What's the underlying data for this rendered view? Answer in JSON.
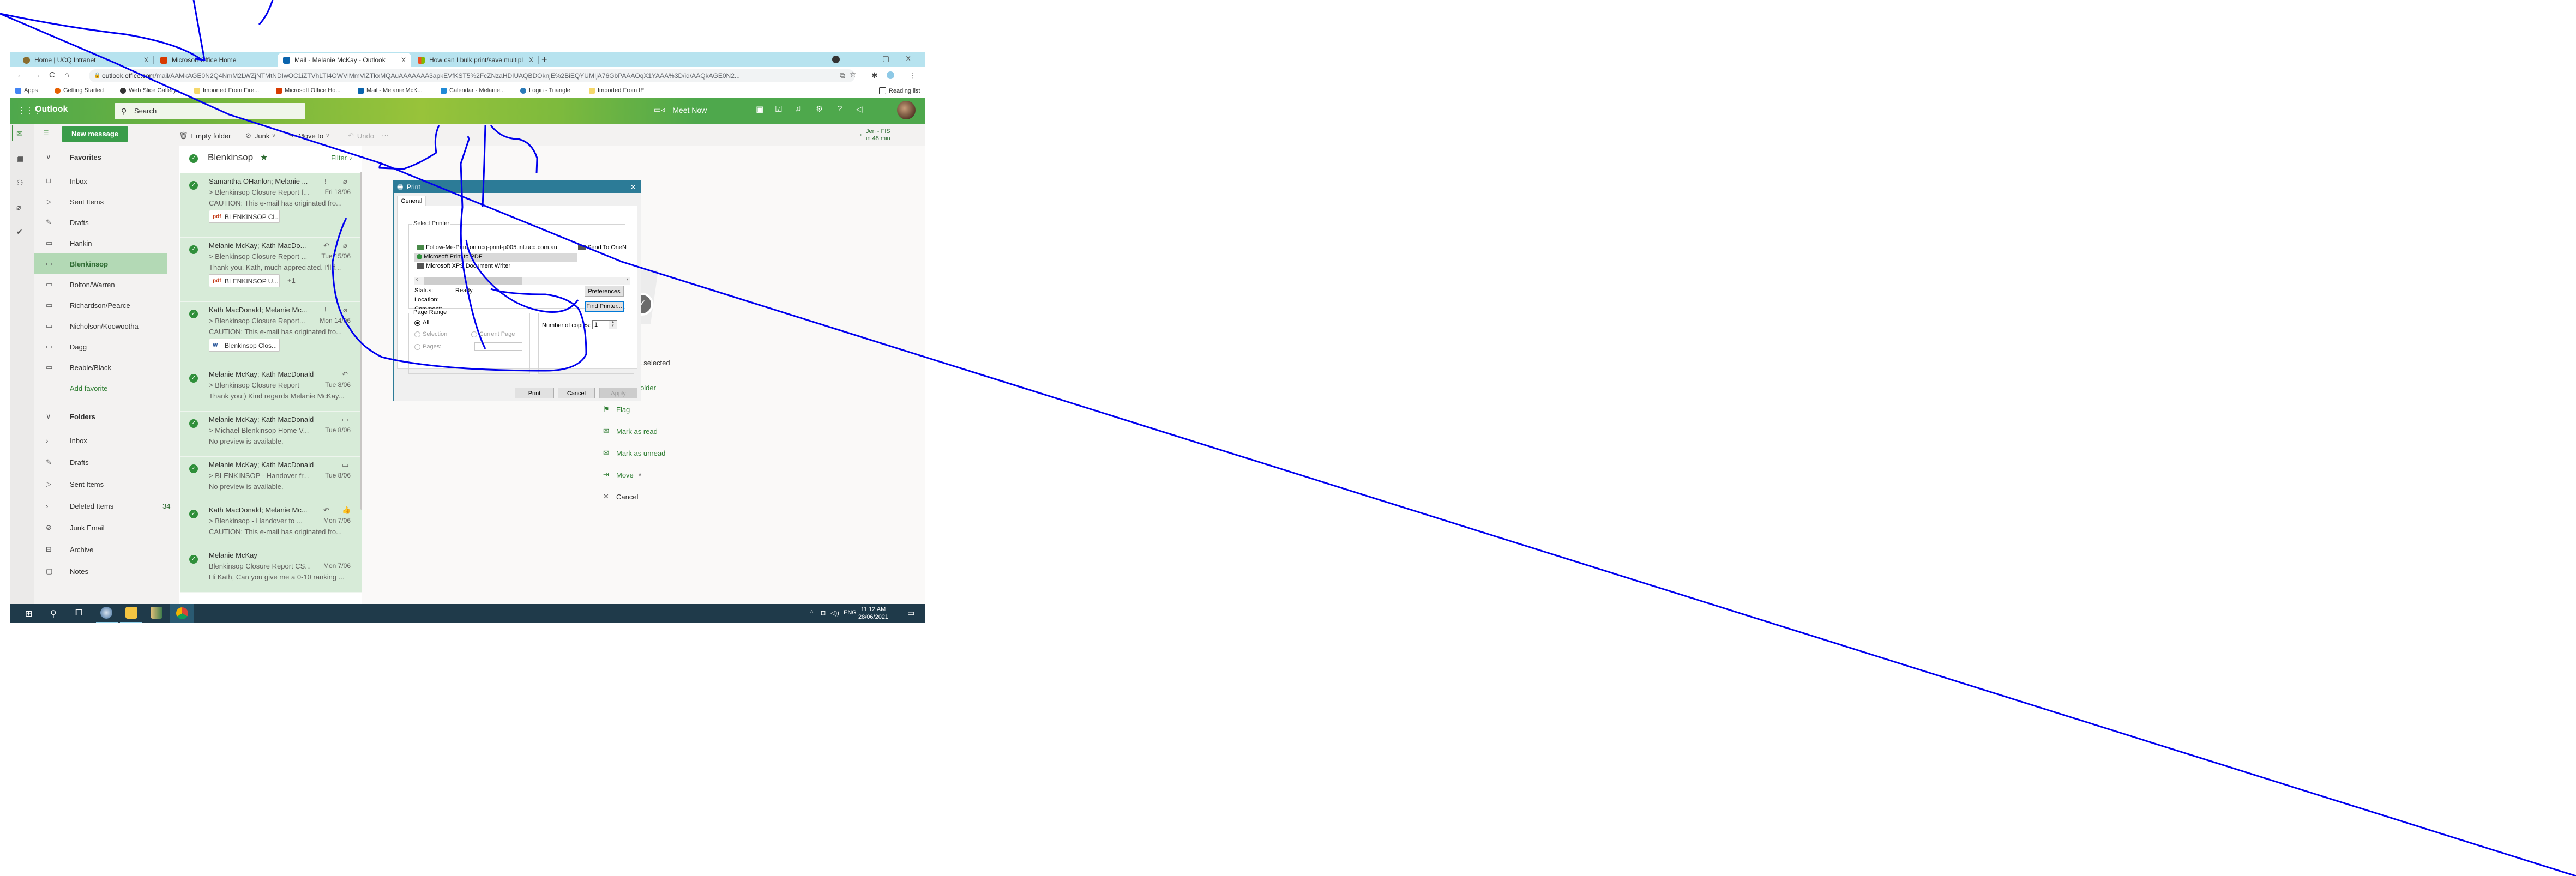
{
  "browser": {
    "tabs": [
      {
        "label": "Home | UCQ Intranet",
        "icon": "ucq-icon",
        "active": false
      },
      {
        "label": "Microsoft Office Home",
        "icon": "office-icon",
        "active": false
      },
      {
        "label": "Mail - Melanie McKay - Outlook",
        "icon": "outlook-icon",
        "active": true
      },
      {
        "label": "How can I bulk print/save multipl",
        "icon": "microsoft-icon",
        "active": false
      }
    ],
    "tab_close": "X",
    "new_tab": "+",
    "window_controls": {
      "minimize": "–",
      "maximize": "▢",
      "close": "X"
    },
    "url_host": "outlook.office.com",
    "url_path": "/mail/AAMkAGE0N2Q4NmM2LWZjNTMtNDIwOC1iZTVhLTI4OWVlMmVlZTkxMQAuAAAAAAA3apkEVfKST5%2FcZNzaHDIUAQBDOknjE%2BiEQYUMIjA76GbPAAAOqX1YAAA%3D/id/AAQkAGE0N2...",
    "bookmarks": [
      {
        "label": "Apps",
        "color": "#4285f4"
      },
      {
        "label": "Getting Started",
        "color": "#e66000"
      },
      {
        "label": "Web Slice Gallery",
        "color": "#333333"
      },
      {
        "label": "Imported From Fire...",
        "color": "#f5d86b"
      },
      {
        "label": "Microsoft Office Ho...",
        "color": "#d83b01"
      },
      {
        "label": "Mail - Melanie McK...",
        "color": "#0a64ad"
      },
      {
        "label": "Calendar - Melanie...",
        "color": "#1f8ad6"
      },
      {
        "label": "Login - Triangle",
        "color": "#2a7ab8"
      },
      {
        "label": "Imported From IE",
        "color": "#f5d86b"
      }
    ],
    "reading_list": "Reading list"
  },
  "outlook": {
    "app_name": "Outlook",
    "search_placeholder": "Search",
    "meet_now": "Meet Now",
    "header_icons": [
      "onenote-icon",
      "todo-icon",
      "bell-icon",
      "gear-icon",
      "help-icon",
      "megaphone-icon"
    ],
    "help_glyph": "?",
    "new_message": "New message",
    "commands": {
      "empty_folder": "Empty folder",
      "junk": "Junk",
      "move_to": "Move to",
      "undo": "Undo",
      "more": "···"
    },
    "upcoming": {
      "title": "Jen - FIS",
      "time": "in 48 min"
    },
    "favorites": {
      "heading": "Favorites",
      "items": [
        {
          "label": "Inbox",
          "icon": "inbox-icon"
        },
        {
          "label": "Sent Items",
          "icon": "send-icon"
        },
        {
          "label": "Drafts",
          "icon": "pencil-icon"
        },
        {
          "label": "Hankin",
          "icon": "folder-icon"
        },
        {
          "label": "Blenkinsop",
          "icon": "folder-icon",
          "selected": true
        },
        {
          "label": "Bolton/Warren",
          "icon": "folder-icon"
        },
        {
          "label": "Richardson/Pearce",
          "icon": "folder-icon"
        },
        {
          "label": "Nicholson/Koowootha",
          "icon": "folder-icon"
        },
        {
          "label": "Dagg",
          "icon": "folder-icon"
        },
        {
          "label": "Beable/Black",
          "icon": "folder-icon"
        }
      ],
      "add_favorite": "Add favorite"
    },
    "folders": {
      "heading": "Folders",
      "items": [
        {
          "label": "Inbox",
          "icon": "chevron-right-icon"
        },
        {
          "label": "Drafts",
          "icon": "pencil-icon"
        },
        {
          "label": "Sent Items",
          "icon": "send-icon"
        },
        {
          "label": "Deleted Items",
          "icon": "chevron-right-icon",
          "count": "34"
        },
        {
          "label": "Junk Email",
          "icon": "blocked-icon"
        },
        {
          "label": "Archive",
          "icon": "archive-icon"
        },
        {
          "label": "Notes",
          "icon": "notes-icon"
        }
      ]
    },
    "message_list": {
      "folder_title": "Blenkinsop",
      "filter": "Filter",
      "messages": [
        {
          "from": "Samantha OHanlon; Melanie ...",
          "subject": "> Blenkinsop Closure Report f...",
          "date": "Fri 18/06",
          "preview": "CAUTION: This e-mail has originated fro...",
          "icons": [
            "!",
            "📎"
          ],
          "attachment": "BLENKINSOP Cl...",
          "attachment_type": "pdf"
        },
        {
          "from": "Melanie McKay; Kath MacDo...",
          "subject": "> Blenkinsop Closure Report ...",
          "date": "Tue 15/06",
          "preview": "Thank you, Kath, much appreciated. I'll f...",
          "icons": [
            "↶",
            "📎"
          ],
          "attachment": "BLENKINSOP U...",
          "attachment_type": "pdf",
          "more": "+1"
        },
        {
          "from": "Kath MacDonald; Melanie Mc...",
          "subject": "> Blenkinsop Closure Report...",
          "date": "Mon 14/06",
          "preview": "CAUTION: This e-mail has originated fro...",
          "icons": [
            "!",
            "📎"
          ],
          "attachment": "Blenkinsop Clos...",
          "attachment_type": "word"
        },
        {
          "from": "Melanie McKay; Kath MacDonald",
          "subject": "> Blenkinsop Closure Report",
          "date": "Tue 8/06",
          "preview": "Thank you:) Kind regards Melanie McKay...",
          "icons": [
            "↶"
          ]
        },
        {
          "from": "Melanie McKay; Kath MacDonald",
          "subject": "> Michael Blenkinsop Home V...",
          "date": "Tue 8/06",
          "preview": "No preview is available.",
          "icons": [
            "📅"
          ]
        },
        {
          "from": "Melanie McKay; Kath MacDonald",
          "subject": "> BLENKINSOP - Handover fr...",
          "date": "Tue 8/06",
          "preview": "No preview is available.",
          "icons": [
            "📅"
          ]
        },
        {
          "from": "Kath MacDonald; Melanie Mc...",
          "subject": "> Blenkinsop - Handover to ...",
          "date": "Mon 7/06",
          "preview": "CAUTION: This e-mail has originated fro...",
          "icons": [
            "↶",
            "👍"
          ]
        },
        {
          "from": "Melanie McKay",
          "subject": "Blenkinsop Closure Report CS...",
          "date": "Mon 7/06",
          "preview": "Hi Kath, Can you give me a 0-10 ranking ...",
          "icons": []
        }
      ]
    },
    "reading_pane": {
      "selected_text": "Blenkinsop is selected",
      "actions": [
        {
          "label": "Empty folder",
          "icon": "trash-icon"
        },
        {
          "label": "Flag",
          "icon": "flag-icon"
        },
        {
          "label": "Mark as read",
          "icon": "envelope-open-icon"
        },
        {
          "label": "Mark as unread",
          "icon": "envelope-icon"
        },
        {
          "label": "Move",
          "icon": "move-icon"
        },
        {
          "label": "Cancel",
          "icon": "close-icon"
        }
      ]
    }
  },
  "print_dialog": {
    "title": "Print",
    "tab": "General",
    "select_printer_label": "Select Printer",
    "printers": [
      {
        "name": "Follow-Me-Print on ucq-print-p005.int.ucq.com.au",
        "selected": false
      },
      {
        "name": "Send To OneN",
        "selected": false
      },
      {
        "name": "Microsoft Print to PDF",
        "selected": true
      },
      {
        "name": "Microsoft XPS Document Writer",
        "selected": false
      }
    ],
    "status_label": "Status:",
    "status_value": "Ready",
    "location_label": "Location:",
    "comment_label": "Comment:",
    "preferences": "Preferences",
    "find_printer": "Find Printer...",
    "page_range_label": "Page Range",
    "range_options": {
      "all": "All",
      "selection": "Selection",
      "current_page": "Current Page",
      "pages": "Pages:"
    },
    "range_selected": "All",
    "copies_label": "Number of copies:",
    "copies_value": "1",
    "buttons": {
      "print": "Print",
      "cancel": "Cancel",
      "apply": "Apply"
    }
  },
  "taskbar": {
    "tray": {
      "caret": "^",
      "lang": "ENG"
    },
    "time": "11:12 AM",
    "date": "28/06/2021"
  }
}
